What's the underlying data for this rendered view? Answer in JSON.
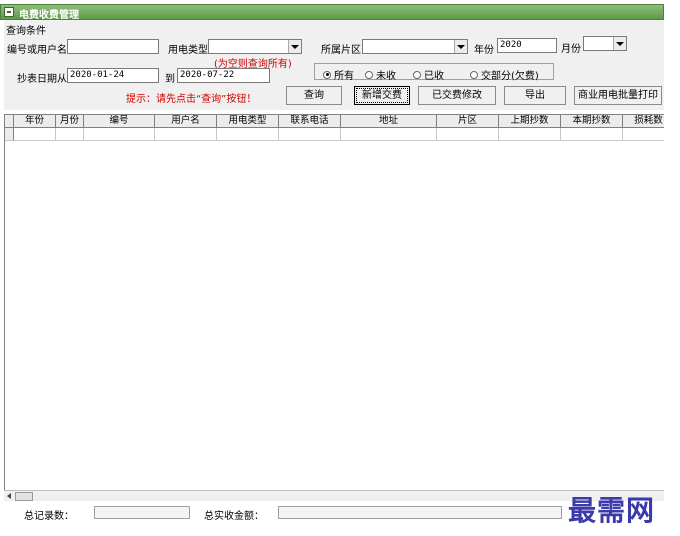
{
  "window": {
    "title": "电费收费管理"
  },
  "query": {
    "group_label": "查询条件",
    "code_label": "编号或用户名",
    "code_value": "",
    "type_label": "用电类型",
    "type_value": "",
    "type_hint": "(为空则查询所有)",
    "area_label": "所属片区",
    "area_value": "",
    "year_label": "年份",
    "year_value": "2020",
    "month_label": "月份",
    "month_value": "",
    "date_from_label": "抄表日期从",
    "date_from": "2020-01-24",
    "date_to_label": "到",
    "date_to": "2020-07-22",
    "tip": "提示：请先点击“查询”按钮！",
    "status_options": [
      {
        "label": "所有",
        "selected": true
      },
      {
        "label": "未收",
        "selected": false
      },
      {
        "label": "已收",
        "selected": false
      },
      {
        "label": "交部分(欠费)",
        "selected": false
      }
    ]
  },
  "buttons": {
    "query": "查询",
    "new_payment": "新增交费",
    "edit_paid": "已交费修改",
    "export": "导出",
    "batch_print": "商业用电批量打印"
  },
  "table": {
    "columns": [
      "年份",
      "月份",
      "编号",
      "用户名",
      "用电类型",
      "联系电话",
      "地址",
      "片区",
      "上期抄数",
      "本期抄数",
      "损耗数"
    ],
    "rows": []
  },
  "status": {
    "total_records_label": "总记录数：",
    "total_records_value": "",
    "total_amount_label": "总实收金额：",
    "total_amount_value": ""
  },
  "watermark": "最需网"
}
